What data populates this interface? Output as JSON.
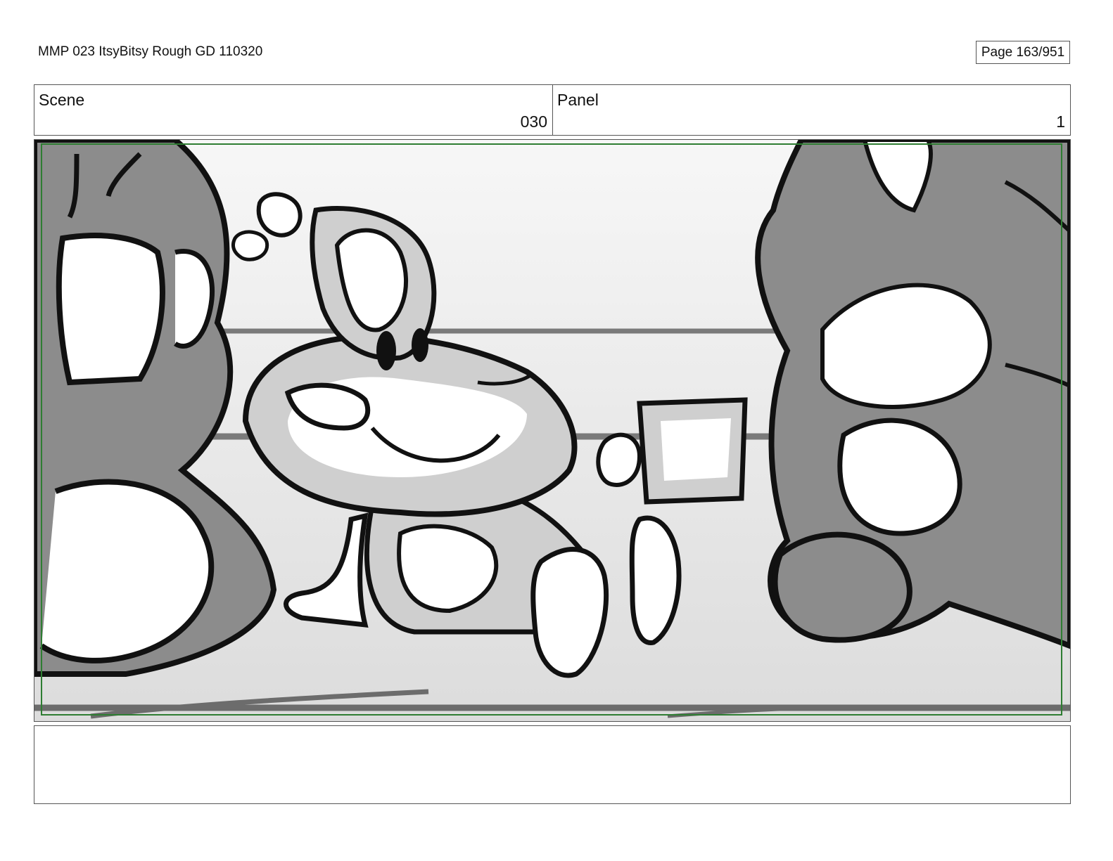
{
  "header": {
    "document_title": "MMP 023 ItsyBitsy Rough GD 110320",
    "page_label": "Page 163/951"
  },
  "scene": {
    "label": "Scene",
    "value": "030"
  },
  "panel": {
    "label": "Panel",
    "value": "1"
  },
  "illustration": {
    "description_icon": "storyboard-sketch-image",
    "colors": {
      "line": "#111111",
      "shade": "#8c8c8c",
      "light": "#cfcfcf",
      "safe_frame": "#2e7d32"
    }
  },
  "notes": {
    "text": ""
  }
}
